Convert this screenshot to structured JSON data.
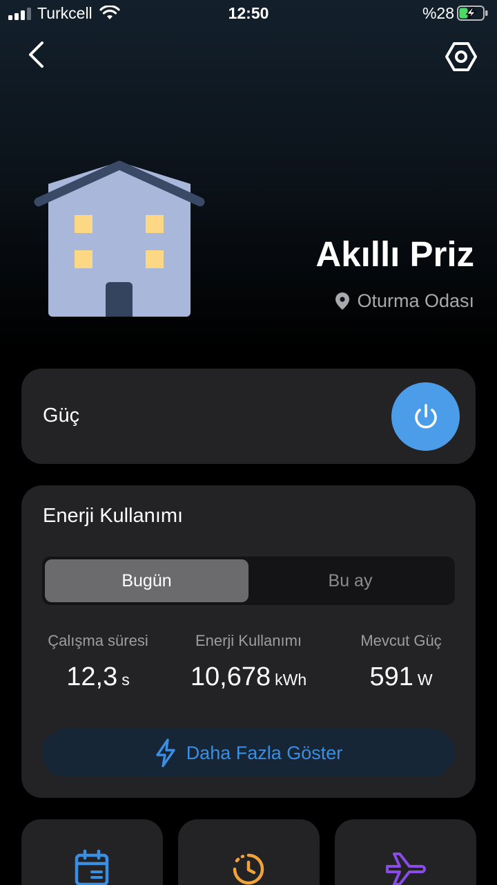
{
  "status_bar": {
    "carrier": "Turkcell",
    "time": "12:50",
    "battery_percent": "%28"
  },
  "header": {
    "back_icon": "chevron-left-icon",
    "settings_icon": "hexagon-settings-icon"
  },
  "device": {
    "name": "Akıllı Priz",
    "location": "Oturma Odası",
    "illustration": "house-icon"
  },
  "power": {
    "label": "Güç",
    "icon": "power-icon",
    "button_color": "#4c9de9"
  },
  "energy": {
    "title": "Enerji Kullanımı",
    "tabs": [
      {
        "label": "Bugün",
        "active": true
      },
      {
        "label": "Bu ay",
        "active": false
      }
    ],
    "stats": [
      {
        "label": "Çalışma süresi",
        "value": "12,3",
        "unit": "s"
      },
      {
        "label": "Enerji Kullanımı",
        "value": "10,678",
        "unit": "kWh"
      },
      {
        "label": "Mevcut Güç",
        "value": "591",
        "unit": "W"
      }
    ],
    "more_button": "Daha Fazla Göster",
    "accent_color": "#3b8fe2"
  },
  "quick_actions": [
    {
      "icon": "calendar-icon",
      "color": "#3b8fe2"
    },
    {
      "icon": "timer-icon",
      "color": "#f0a33a"
    },
    {
      "icon": "airplane-icon",
      "color": "#8a4be6"
    }
  ]
}
